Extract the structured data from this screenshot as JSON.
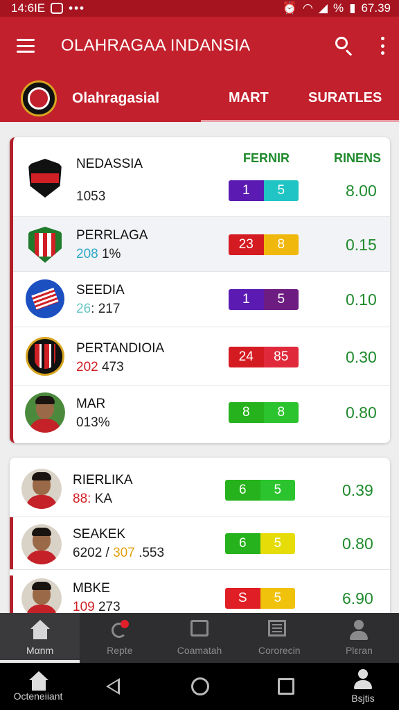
{
  "status_bar": {
    "time": "14:6IE",
    "dots": "•••",
    "battery": "67.39",
    "signal": "%"
  },
  "app_bar": {
    "title": "OLAHRAGAA INDANSIA",
    "subtitle": "Olahragasial",
    "tabs": [
      {
        "label": "MART"
      },
      {
        "label": "SURATLES"
      }
    ]
  },
  "columns": {
    "col1": "FERNIR",
    "col2": "RINENS"
  },
  "rows": [
    {
      "name": "NEDASSIA",
      "stat_a": "",
      "stat_b": "1053",
      "pill_left": "1",
      "pill_right": "5",
      "pill_colors": [
        "#5b1bb3",
        "#21c4c4"
      ],
      "value": "8.00"
    },
    {
      "name": "PERRLAGA",
      "stat_a": "208",
      "stat_b": " 1%",
      "pill_left": "23",
      "pill_right": "8",
      "pill_colors": [
        "#d51b22",
        "#f0b80c"
      ],
      "value": "0.15"
    },
    {
      "name": "SEEDIA",
      "stat_a": "26",
      "stat_b": ": 217",
      "pill_left": "1",
      "pill_right": "5",
      "pill_colors": [
        "#5b1bb3",
        "#6d1d82"
      ],
      "value": "0.10"
    },
    {
      "name": "PERTANDIOIA",
      "stat_a": "202",
      "stat_b": " 473",
      "pill_left": "24",
      "pill_right": "85",
      "pill_colors": [
        "#d51b22",
        "#e02a3c"
      ],
      "value": "0.30"
    },
    {
      "name": "MAR",
      "stat_a": "01",
      "stat_b": "3%",
      "pill_left": "8",
      "pill_right": "8",
      "pill_colors": [
        "#26b21c",
        "#2cc42e"
      ],
      "value": "0.80"
    },
    {
      "name": "RIERLIKA",
      "stat_a": "88:",
      "stat_b": " KA",
      "pill_left": "6",
      "pill_right": "5",
      "pill_colors": [
        "#26b21c",
        "#2cc42e"
      ],
      "value": "0.39"
    },
    {
      "name": "SEAKEK",
      "stat_a": "6202 / ",
      "stat_b": "307",
      "stat_c": " .553",
      "pill_left": "6",
      "pill_right": "5",
      "pill_colors": [
        "#26b21c",
        "#e6dc08"
      ],
      "value": "0.80"
    },
    {
      "name": "MBKE",
      "stat_a": "109",
      "stat_b": " 273",
      "pill_left": "S",
      "pill_right": "5",
      "pill_colors": [
        "#e01e25",
        "#f0c20c"
      ],
      "value": "6.90"
    }
  ],
  "bottom_nav": [
    {
      "label": "Mαnm",
      "icon": "home-icon"
    },
    {
      "label": "Repte",
      "icon": "replay-icon"
    },
    {
      "label": "Coamatah",
      "icon": "box-icon"
    },
    {
      "label": "Cororecin",
      "icon": "list-icon"
    },
    {
      "label": "Plεran",
      "icon": "user-icon"
    }
  ],
  "system_nav": {
    "home_label": "Octeneiiant",
    "profile_label": "Bsjtis"
  },
  "colors": {
    "brand": "#c2202c",
    "accent_green": "#1e8a2c"
  }
}
